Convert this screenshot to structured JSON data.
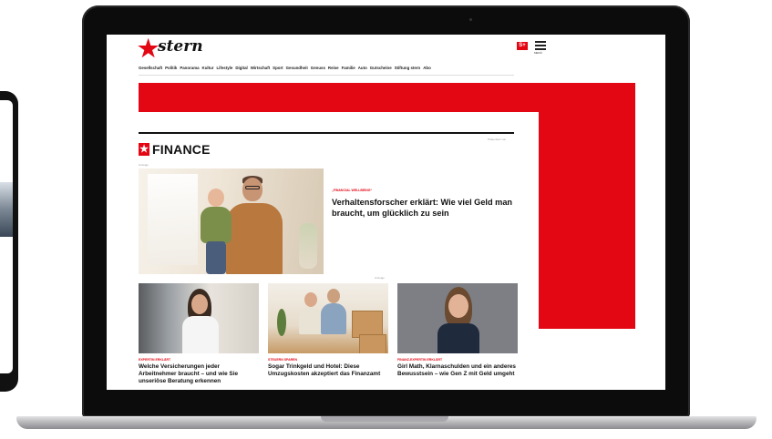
{
  "site": {
    "logo_text": "stern",
    "plus_badge": "S+",
    "menu_label": "MENÜ"
  },
  "nav": {
    "items": [
      "Gesellschaft",
      "Politik",
      "Panorama",
      "Kultur",
      "Lifestyle",
      "Digital",
      "Wirtschaft",
      "Sport",
      "Gesundheit",
      "Genuss",
      "Reise",
      "Familie",
      "Auto",
      "Gutscheine",
      "Stiftung stern",
      "Abo"
    ]
  },
  "section": {
    "title": "FINANCE",
    "presented": "Präsentiert von",
    "anzeige": "Anzeige"
  },
  "hero": {
    "kicker": "„FINANCIAL WELLBEING“",
    "title": "Verhaltensforscher erklärt: Wie viel Geld man braucht, um glücklich zu sein"
  },
  "cards": [
    {
      "kicker": "EXPERTIN ERKLÄRT",
      "title": "Welche Versicherungen jeder Arbeitnehmer braucht – und wie Sie unseriöse Beratung erkennen"
    },
    {
      "kicker": "STEUERN SPAREN",
      "title": "Sogar Trinkgeld und Hotel: Diese Umzugskosten akzeptiert das Finanzamt"
    },
    {
      "kicker": "FINANZ-EXPERTIN ERKLÄRT",
      "title": "Girl Math, Klarnaschulden und ein anderes Bewusstsein – wie Gen Z mit Geld umgeht"
    }
  ],
  "colors": {
    "brand_red": "#e30613",
    "text": "#111111"
  }
}
